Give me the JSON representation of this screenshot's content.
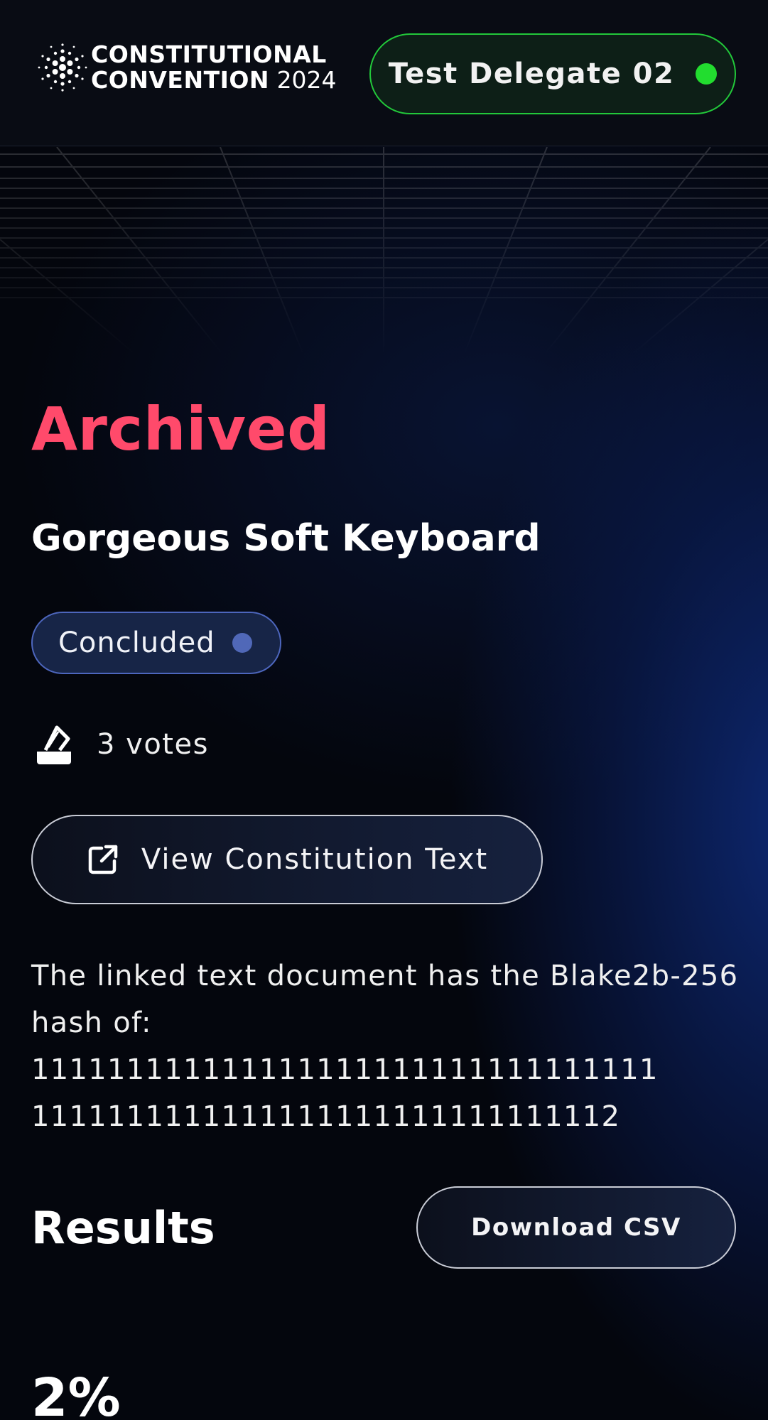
{
  "header": {
    "logo": {
      "line1": "CONSTITUTIONAL",
      "line2_bold": "CONVENTION",
      "line2_year": "2024",
      "icon": "cardano-dots-icon"
    },
    "delegate": {
      "label": "Test Delegate 02",
      "status_color": "#22dd2f"
    }
  },
  "proposal": {
    "status_heading": "Archived",
    "title": "Gorgeous Soft Keyboard",
    "badge": {
      "label": "Concluded",
      "dot_color": "#5068b8"
    },
    "votes": {
      "icon": "ballot-box-icon",
      "label": "3 votes"
    },
    "view_button": {
      "icon": "external-link-icon",
      "label": "View Constitution Text"
    },
    "hash_intro": "The linked text document has the Blake2b-256 hash of:",
    "hash_line1": "111111111111111111111111111111111",
    "hash_line2": "1111111111111111111111111111112"
  },
  "results": {
    "title": "Results",
    "download_label": "Download CSV",
    "first_percent": "2%"
  },
  "colors": {
    "archived": "#ff4a6b",
    "delegate_border": "#22c83a",
    "badge_border": "#4d66bd"
  }
}
